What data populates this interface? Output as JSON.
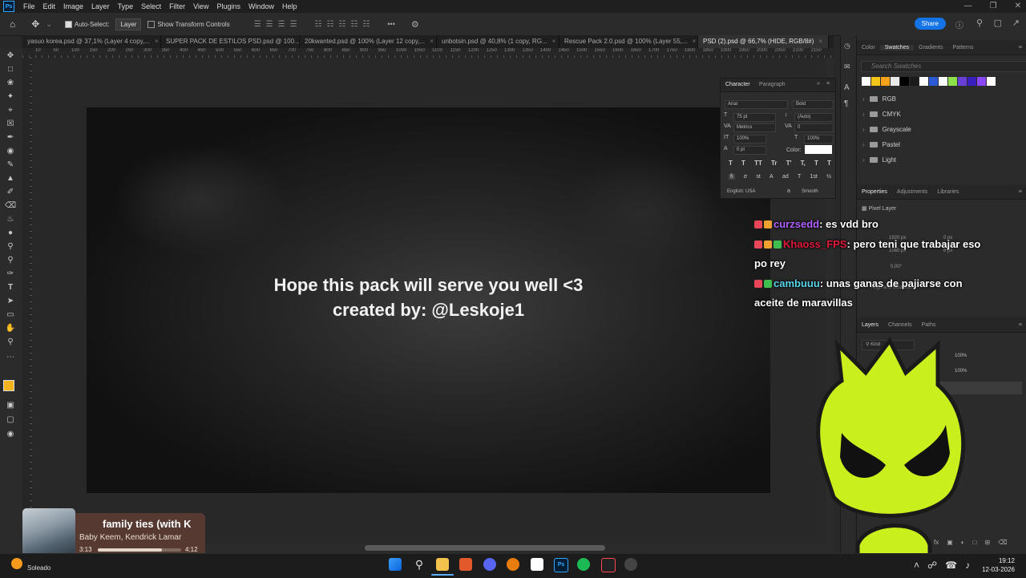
{
  "menubar": {
    "logo": "Ps",
    "items": [
      "File",
      "Edit",
      "Image",
      "Layer",
      "Type",
      "Select",
      "Filter",
      "View",
      "Plugins",
      "Window",
      "Help"
    ]
  },
  "options": {
    "auto_select": "Auto-Select:",
    "layer": "Layer",
    "show_transform": "Show Transform Controls",
    "more": "•••",
    "share": "Share"
  },
  "tabs": [
    {
      "label": "yasuo korea.psd @ 37,1% (Layer 4 copy,..."
    },
    {
      "label": "SUPER PACK DE ESTILOS PSD.psd @ 100..."
    },
    {
      "label": "20kwanted.psd @ 100% (Layer 12 copy,..."
    },
    {
      "label": "unbotsin.psd @ 40,8% (1 copy, RG..."
    },
    {
      "label": "Rescue Pack 2.0.psd @ 100% (Layer 55,..."
    },
    {
      "label": "PSD (2).psd @ 66,7% (HIDE, RGB/8#)"
    }
  ],
  "ruler": {
    "labels": [
      "10",
      "50",
      "100",
      "150",
      "200",
      "250",
      "300",
      "350",
      "400",
      "450",
      "500",
      "550",
      "600",
      "650",
      "700",
      "750",
      "800",
      "850",
      "900",
      "950",
      "1000",
      "1050",
      "1100",
      "1150",
      "1200",
      "1250",
      "1300",
      "1350",
      "1400",
      "1450",
      "1500",
      "1550",
      "1600",
      "1650",
      "1700",
      "1750",
      "1800",
      "1850",
      "1900",
      "1950",
      "2000",
      "2050",
      "2100",
      "2150"
    ]
  },
  "canvas": {
    "line1": "Hope this pack will serve you well <3",
    "line2": "created by: @Leskoje1"
  },
  "character_panel": {
    "tab_character": "Character",
    "tab_paragraph": "Paragraph",
    "font": "Arial",
    "style": "Bold",
    "size": "75 pt",
    "leading": "(Auto)",
    "kerning": "Metrics",
    "tracking": "0",
    "vscale": "100%",
    "hscale": "100%",
    "baseline": "0 pt",
    "color_label": "Color:",
    "type_buttons": [
      "T",
      "T",
      "TT",
      "Tr",
      "T'",
      "T,",
      "T",
      "T"
    ],
    "ot_buttons": [
      "fi",
      "σ",
      "st",
      "A",
      "ad",
      "T",
      "1st",
      "½"
    ],
    "language": "English: USA",
    "aa_label": "a",
    "aa": "Smooth"
  },
  "swatches_panel": {
    "tabs": [
      "Color",
      "Swatches",
      "Gradients",
      "Patterns"
    ],
    "search_placeholder": "Search Swatches",
    "colors": [
      "#ffffff",
      "#f5c518",
      "#f7a21b",
      "#e9e9e9",
      "#000000",
      "#1b1b1b",
      "#ffffff",
      "#2d5bd6",
      "#ffffff",
      "#8de04a",
      "#6a3fd8",
      "#3b1fbd",
      "#8a47f5",
      "#ffffff"
    ],
    "folders": [
      "RGB",
      "CMYK",
      "Grayscale",
      "Pastel",
      "Light"
    ]
  },
  "properties_panel": {
    "tabs": [
      "Properties",
      "Adjustments",
      "Libraries"
    ],
    "type": "Pixel Layer",
    "w": "1920 px",
    "h": "1080 px",
    "x": "0 px",
    "y": "6 px",
    "angle": "0,00°",
    "align": "Align and Distribute"
  },
  "layers_panel": {
    "tabs": [
      "Layers",
      "Channels",
      "Paths"
    ],
    "kind": "Kind",
    "opacity": "100%",
    "fill": "100%"
  },
  "chat": [
    {
      "user": "curzsedd",
      "user_color": "#b060ff",
      "msg": "es vdd bro",
      "badges": [
        "#e8475a",
        "#f0a030"
      ]
    },
    {
      "user": "Khaoss_FPS",
      "user_color": "#e0193b",
      "msg": "pero teni que trabajar eso",
      "msg2": "po rey",
      "badges": [
        "#e8475a",
        "#f0a030",
        "#3fbf4f"
      ]
    },
    {
      "user": "cambuuu",
      "user_color": "#58d4e8",
      "msg": "unas ganas de pajiarse con",
      "msg2": "aceite de maravillas",
      "badges": [
        "#e8475a",
        "#3fbf4f"
      ]
    }
  ],
  "music": {
    "title": "family ties (with K",
    "artist": "Baby Keem, Kendrick Lamar",
    "elapsed": "3:13",
    "duration": "4:12",
    "progress": 0.766
  },
  "taskbar": {
    "weather": "Soleado",
    "time": "19:12",
    "date": "12-03-2026"
  }
}
